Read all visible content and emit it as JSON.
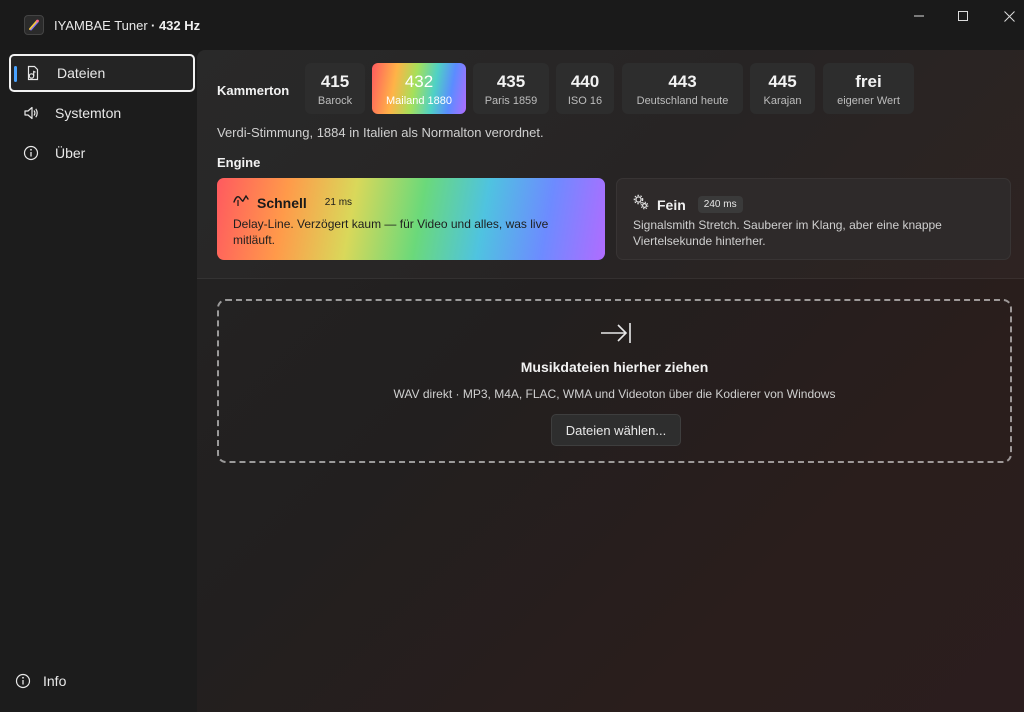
{
  "window": {
    "app_name": "IYAMBAE Tuner",
    "hz_label": "· 432 Hz",
    "icons": [
      "app-icon",
      "minimize-icon",
      "maximize-icon",
      "close-icon"
    ]
  },
  "sidebar": {
    "items": [
      {
        "label": "Dateien",
        "icon": "files-icon",
        "selected": true
      },
      {
        "label": "Systemton",
        "icon": "speaker-icon",
        "selected": false
      },
      {
        "label": "Über",
        "icon": "info-icon",
        "selected": false
      }
    ],
    "footer": {
      "label": "Info",
      "icon": "info-icon"
    }
  },
  "main": {
    "kammerton": {
      "label": "Kammerton",
      "options": [
        {
          "value": "415",
          "caption": "Barock"
        },
        {
          "value": "432",
          "caption": "Mailand 1880",
          "active": true
        },
        {
          "value": "435",
          "caption": "Paris 1859"
        },
        {
          "value": "440",
          "caption": "ISO 16"
        },
        {
          "value": "443",
          "caption": "Deutschland heute"
        },
        {
          "value": "445",
          "caption": "Karajan"
        },
        {
          "value": "frei",
          "caption": "eigener Wert"
        }
      ],
      "description": "Verdi-Stimmung, 1884 in Italien als Normalton verordnet."
    },
    "engine": {
      "label": "Engine",
      "options": [
        {
          "name": "Schnell",
          "latency": "21 ms",
          "description": "Delay-Line. Verzögert kaum — für Video und alles, was live mitläuft.",
          "icon": "waveform-icon",
          "active": true
        },
        {
          "name": "Fein",
          "latency": "240 ms",
          "description": "Signalsmith Stretch. Sauberer im Klang, aber eine knappe Viertelsekunde hinterher.",
          "icon": "gears-icon",
          "active": false
        }
      ]
    },
    "dropzone": {
      "icon": "import-arrow-icon",
      "title": "Musikdateien hierher ziehen",
      "subtitle": "WAV direkt · MP3, M4A, FLAC, WMA und Videoton über die Kodierer von Windows",
      "button_label": "Dateien wählen..."
    }
  },
  "colors": {
    "accent_indicator": "#4aa3ff",
    "background": "#1a1a1a"
  }
}
